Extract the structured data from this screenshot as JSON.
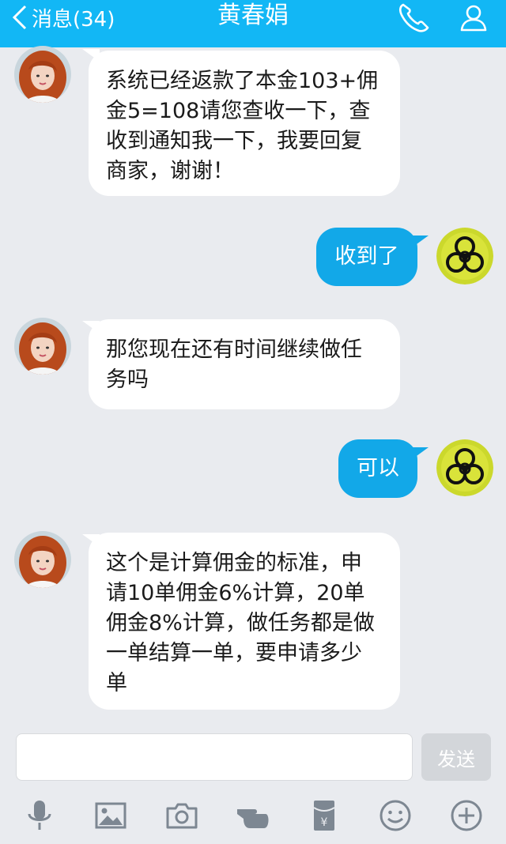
{
  "header": {
    "back_label": "消息(34)",
    "title": "黄春娟"
  },
  "messages": [
    {
      "side": "in",
      "text": "系统已经返款了本金103+佣金5=108请您查收一下，查收到通知我一下，我要回复商家，谢谢！"
    },
    {
      "side": "out",
      "text": "收到了"
    },
    {
      "side": "in",
      "text": "那您现在还有时间继续做任务吗"
    },
    {
      "side": "out",
      "text": "可以"
    },
    {
      "side": "in",
      "text": "这个是计算佣金的标准，申请10单佣金6%计算，20单佣金8%计算，做任务都是做一单结算一单，要申请多少单"
    }
  ],
  "composer": {
    "input_value": "",
    "send_label": "发送"
  },
  "toolbar": {
    "icons": [
      "microphone-icon",
      "image-icon",
      "camera-icon",
      "poke-icon",
      "red-packet-icon",
      "emoji-icon",
      "plus-icon"
    ]
  },
  "colors": {
    "header": "#12b7f5",
    "outgoing_bubble": "#12a8e8",
    "incoming_bubble": "#ffffff",
    "background": "#e9ebef"
  }
}
